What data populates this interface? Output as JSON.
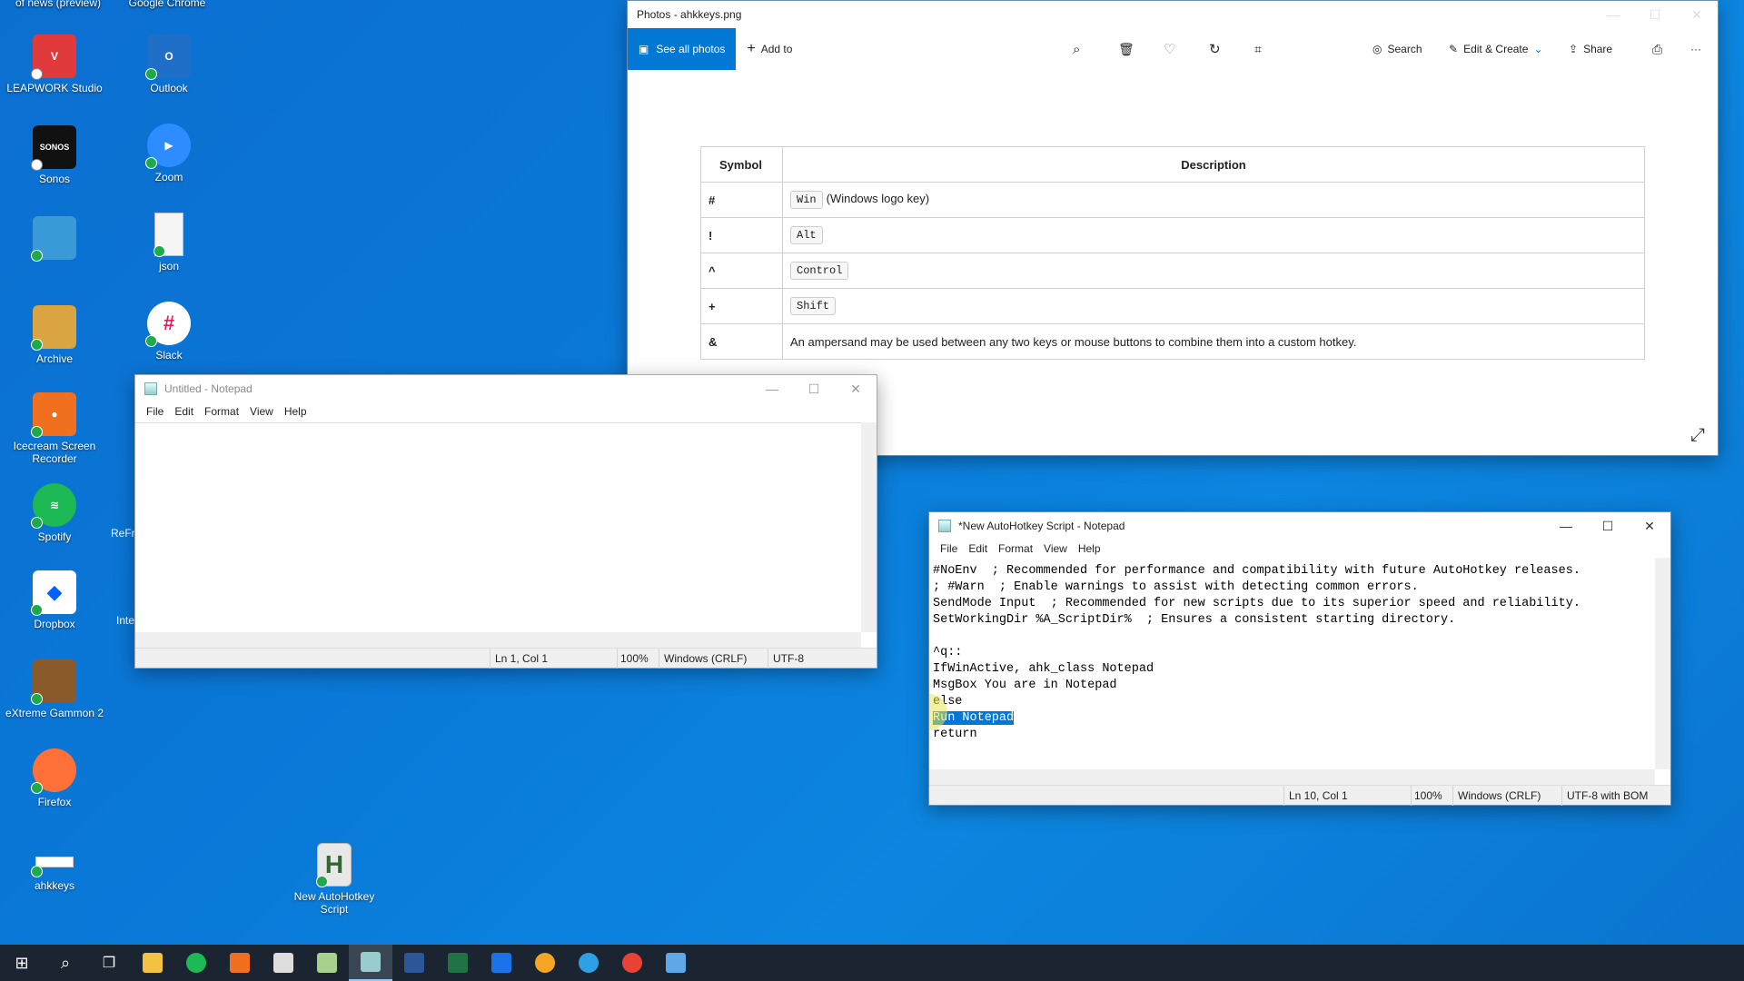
{
  "desktop": {
    "top_labels": [
      "of news (preview)",
      "Google Chrome"
    ],
    "icons": [
      {
        "label": "LEAPWORK Studio",
        "color": "#e03a3a"
      },
      {
        "label": "Outlook",
        "color": "#1f6fc8"
      },
      {
        "label": "Sonos",
        "color": "#111111"
      },
      {
        "label": "Zoom",
        "color": "#2d8cff"
      },
      {
        "label": "",
        "color": "#3a9ad8"
      },
      {
        "label": "json",
        "color": "#f5f5f5"
      },
      {
        "label": "Archive",
        "color": "#d9a441"
      },
      {
        "label": "Slack",
        "color": "#ffffff"
      },
      {
        "label": "Icecream Screen Recorder",
        "color": "#f07020"
      },
      {
        "label": "Spotify",
        "color": "#1db954"
      },
      {
        "label": "Dropbox",
        "color": "#0061ff"
      },
      {
        "label": "eXtreme Gammon 2",
        "color": "#8b5a2b"
      },
      {
        "label": "Firefox",
        "color": "#ff7139"
      },
      {
        "label": "ahkkeys",
        "color": "#ffffff"
      },
      {
        "label": "New AutoHotkey Script",
        "color": "#e8e8e8"
      }
    ],
    "partial_labels": [
      "ReFr",
      "Inte"
    ],
    "sonos_text": "SONOS",
    "ahk_letter": "H"
  },
  "photos": {
    "title": "Photos - ahkkeys.png",
    "see_all": "See all photos",
    "add_to": "Add to",
    "search": "Search",
    "edit_create": "Edit & Create",
    "share": "Share",
    "more": "···",
    "table": {
      "headers": [
        "Symbol",
        "Description"
      ],
      "rows": [
        {
          "symbol": "#",
          "key": "Win",
          "desc": "(Windows logo key)"
        },
        {
          "symbol": "!",
          "key": "Alt",
          "desc": ""
        },
        {
          "symbol": "^",
          "key": "Control",
          "desc": ""
        },
        {
          "symbol": "+",
          "key": "Shift",
          "desc": ""
        },
        {
          "symbol": "&",
          "key": "",
          "desc": "An ampersand may be used between any two keys or mouse buttons to combine them into a custom hotkey."
        }
      ]
    }
  },
  "notepad1": {
    "title": "Untitled - Notepad",
    "menu": [
      "File",
      "Edit",
      "Format",
      "View",
      "Help"
    ],
    "status": {
      "pos": "Ln 1, Col 1",
      "zoom": "100%",
      "eol": "Windows (CRLF)",
      "enc": "UTF-8"
    }
  },
  "notepad2": {
    "title": "*New AutoHotkey Script - Notepad",
    "menu": [
      "File",
      "Edit",
      "Format",
      "View",
      "Help"
    ],
    "lines": [
      "#NoEnv  ; Recommended for performance and compatibility with future AutoHotkey releases.",
      "; #Warn  ; Enable warnings to assist with detecting common errors.",
      "SendMode Input  ; Recommended for new scripts due to its superior speed and reliability.",
      "SetWorkingDir %A_ScriptDir%  ; Ensures a consistent starting directory.",
      "",
      "^q::",
      "IfWinActive, ahk_class Notepad",
      "MsgBox You are in Notepad",
      "else"
    ],
    "selected_line": "Run Notepad",
    "last_line": "return",
    "status": {
      "pos": "Ln 10, Col 1",
      "zoom": "100%",
      "eol": "Windows (CRLF)",
      "enc": "UTF-8 with BOM"
    }
  },
  "taskbar": {
    "icons": [
      {
        "name": "windows",
        "color": "#ffffff"
      },
      {
        "name": "search",
        "color": "#ffffff"
      },
      {
        "name": "task-view",
        "color": "#ffffff"
      },
      {
        "name": "file-explorer",
        "color": "#f3c242"
      },
      {
        "name": "spotify",
        "color": "#1db954"
      },
      {
        "name": "icecream",
        "color": "#f07020"
      },
      {
        "name": "calculator",
        "color": "#dddddd"
      },
      {
        "name": "notepad-plus",
        "color": "#a8d08d"
      },
      {
        "name": "notepad",
        "color": "#9cc"
      },
      {
        "name": "word",
        "color": "#2b579a"
      },
      {
        "name": "excel",
        "color": "#217346"
      },
      {
        "name": "uipath",
        "color": "#1a73e8"
      },
      {
        "name": "app-orange",
        "color": "#f5a623"
      },
      {
        "name": "edge",
        "color": "#2ea1e6"
      },
      {
        "name": "chrome",
        "color": "#e94235"
      },
      {
        "name": "photos",
        "color": "#5fa8e8"
      }
    ]
  }
}
